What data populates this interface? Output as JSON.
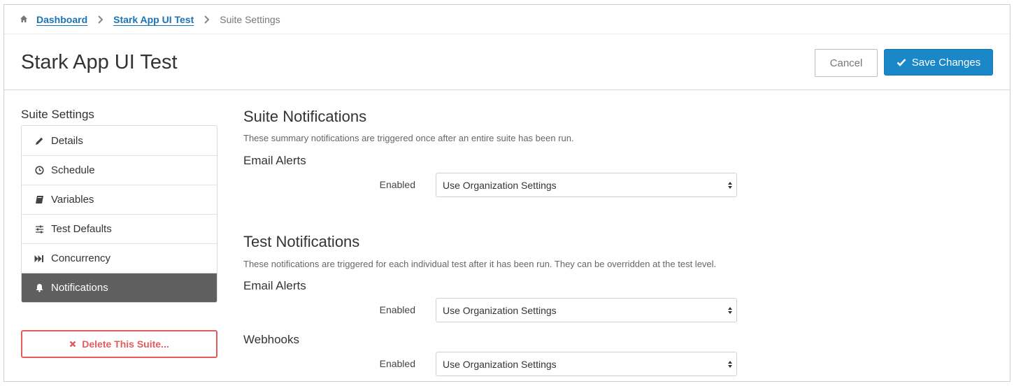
{
  "breadcrumb": {
    "items": [
      "Dashboard",
      "Stark App UI Test"
    ],
    "current": "Suite Settings"
  },
  "header": {
    "title": "Stark App UI Test",
    "cancel_label": "Cancel",
    "save_label": "Save Changes"
  },
  "sidebar": {
    "title": "Suite Settings",
    "items": [
      {
        "label": "Details",
        "icon": "pencil-icon"
      },
      {
        "label": "Schedule",
        "icon": "clock-icon"
      },
      {
        "label": "Variables",
        "icon": "book-icon"
      },
      {
        "label": "Test Defaults",
        "icon": "sliders-icon"
      },
      {
        "label": "Concurrency",
        "icon": "fast-forward-icon"
      },
      {
        "label": "Notifications",
        "icon": "bell-icon",
        "active": true
      }
    ],
    "delete_label": "Delete This Suite..."
  },
  "suite_notifications": {
    "title": "Suite Notifications",
    "description": "These summary notifications are triggered once after an entire suite has been run.",
    "email_alerts": {
      "title": "Email Alerts",
      "label": "Enabled",
      "value": "Use Organization Settings"
    }
  },
  "test_notifications": {
    "title": "Test Notifications",
    "description": "These notifications are triggered for each individual test after it has been run. They can be overridden at the test level.",
    "email_alerts": {
      "title": "Email Alerts",
      "label": "Enabled",
      "value": "Use Organization Settings"
    },
    "webhooks": {
      "title": "Webhooks",
      "label": "Enabled",
      "value": "Use Organization Settings"
    }
  },
  "colors": {
    "link": "#1a73b5",
    "primary": "#1a87c9",
    "active_sidebar": "#5f5f5f",
    "danger": "#e35b5b"
  }
}
